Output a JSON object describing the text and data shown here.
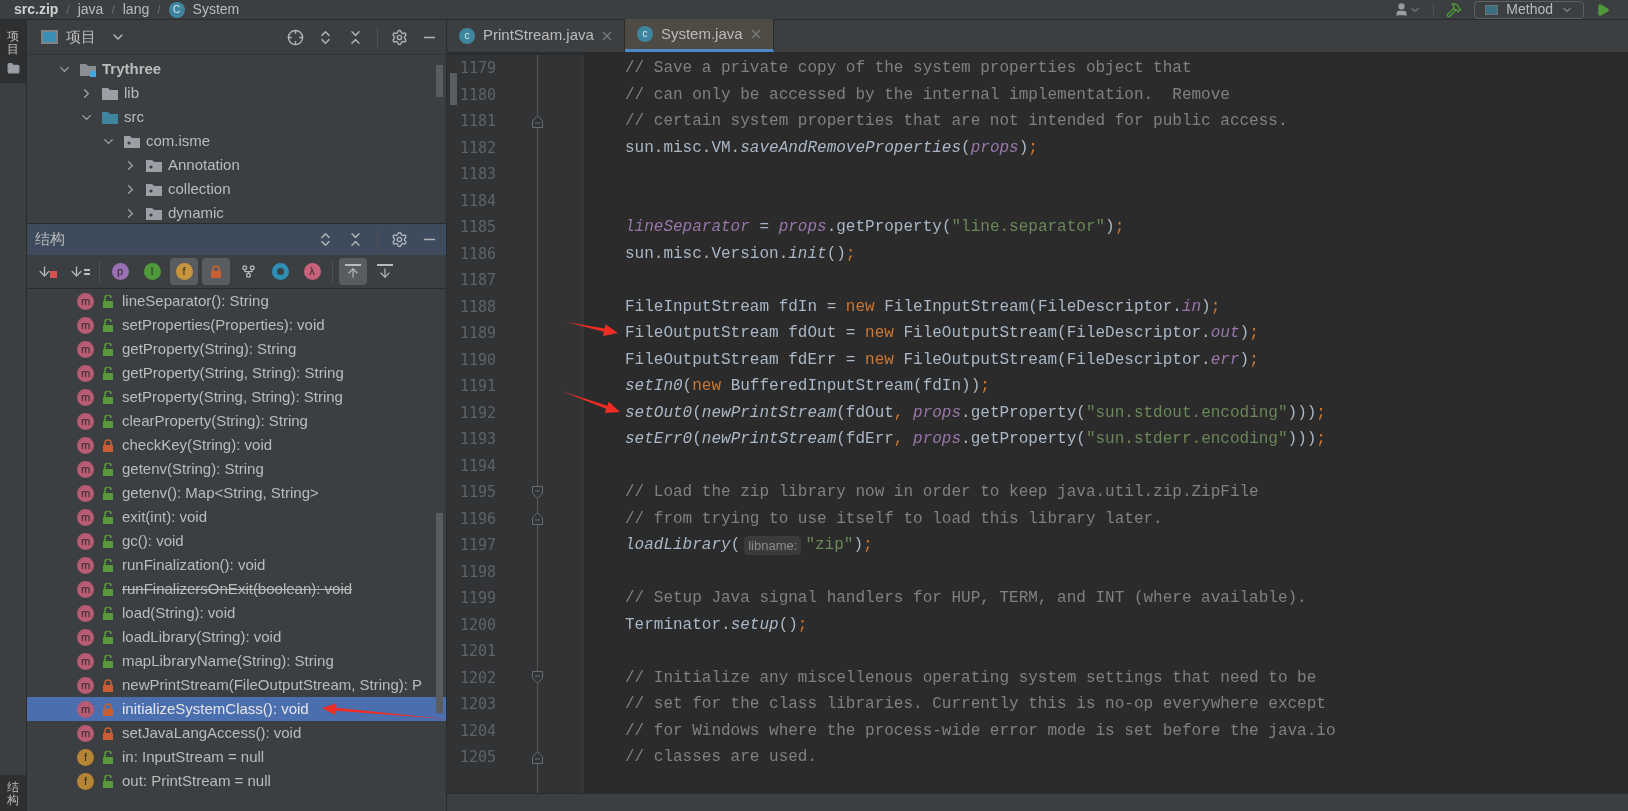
{
  "breadcrumb": [
    {
      "kind": "item",
      "label": "src.zip"
    },
    {
      "kind": "separator",
      "label": "/"
    },
    {
      "kind": "item",
      "label": "java"
    },
    {
      "kind": "separator",
      "label": "/"
    },
    {
      "kind": "item",
      "label": "lang"
    },
    {
      "kind": "separator",
      "label": "/"
    },
    {
      "kind": "item",
      "label": "System",
      "badge": "C"
    }
  ],
  "toolbar": {
    "run_config": "Method"
  },
  "side_tabs": {
    "top": {
      "label": "项目",
      "selected": true
    },
    "bottom": {
      "label": "结构",
      "selected": true
    }
  },
  "project": {
    "title": "项目",
    "tree": [
      {
        "label": "Trythree",
        "kind": "module",
        "expanded": true,
        "children": [
          {
            "label": "lib",
            "kind": "folder",
            "expanded": false
          },
          {
            "label": "src",
            "kind": "source_folder",
            "expanded": true,
            "children": [
              {
                "label": "com.isme",
                "kind": "package",
                "expanded": true,
                "children": [
                  {
                    "label": "Annotation",
                    "kind": "package",
                    "expanded": false
                  },
                  {
                    "label": "collection",
                    "kind": "package",
                    "expanded": false
                  },
                  {
                    "label": "dynamic",
                    "kind": "package",
                    "expanded": false
                  }
                ]
              }
            ]
          }
        ]
      }
    ]
  },
  "structure": {
    "title": "结构",
    "toolbar": [
      {
        "kind": "sort_visibility",
        "selected": false
      },
      {
        "kind": "sort_alpha",
        "selected": false
      },
      {
        "kind": "badge",
        "label": "p",
        "color": "#9b6fb3",
        "selected": false
      },
      {
        "kind": "badge",
        "label": "I",
        "color": "#4e9a3a",
        "selected": false
      },
      {
        "kind": "badge",
        "label": "f",
        "color": "#c7953c",
        "selected": true
      },
      {
        "kind": "lock",
        "selected": true
      },
      {
        "kind": "hierarchy",
        "selected": false
      },
      {
        "kind": "ring",
        "color": "#2e8fb5",
        "selected": false
      },
      {
        "kind": "badge",
        "label": "λ",
        "color": "#c7627a",
        "selected": false
      },
      {
        "kind": "scroll_from_source",
        "selected": true
      },
      {
        "kind": "scroll_to_source",
        "selected": false
      }
    ],
    "members": [
      {
        "kind": "method",
        "badge": "m",
        "private": false,
        "label": "lineSeparator(): String",
        "deprecated": false,
        "selected": false
      },
      {
        "kind": "method",
        "badge": "m",
        "private": false,
        "label": "setProperties(Properties): void",
        "deprecated": false,
        "selected": false
      },
      {
        "kind": "method",
        "badge": "m",
        "private": false,
        "label": "getProperty(String): String",
        "deprecated": false,
        "selected": false
      },
      {
        "kind": "method",
        "badge": "m",
        "private": false,
        "label": "getProperty(String, String): String",
        "deprecated": false,
        "selected": false
      },
      {
        "kind": "method",
        "badge": "m",
        "private": false,
        "label": "setProperty(String, String): String",
        "deprecated": false,
        "selected": false
      },
      {
        "kind": "method",
        "badge": "m",
        "private": false,
        "label": "clearProperty(String): String",
        "deprecated": false,
        "selected": false
      },
      {
        "kind": "method",
        "badge": "m",
        "private": true,
        "label": "checkKey(String): void",
        "deprecated": false,
        "selected": false
      },
      {
        "kind": "method",
        "badge": "m",
        "private": false,
        "label": "getenv(String): String",
        "deprecated": false,
        "selected": false
      },
      {
        "kind": "method",
        "badge": "m",
        "private": false,
        "label": "getenv(): Map<String, String>",
        "deprecated": false,
        "selected": false
      },
      {
        "kind": "method",
        "badge": "m",
        "private": false,
        "label": "exit(int): void",
        "deprecated": false,
        "selected": false
      },
      {
        "kind": "method",
        "badge": "m",
        "private": false,
        "label": "gc(): void",
        "deprecated": false,
        "selected": false
      },
      {
        "kind": "method",
        "badge": "m",
        "private": false,
        "label": "runFinalization(): void",
        "deprecated": false,
        "selected": false
      },
      {
        "kind": "method",
        "badge": "m",
        "private": false,
        "label": "runFinalizersOnExit(boolean): void",
        "deprecated": true,
        "selected": false
      },
      {
        "kind": "method",
        "badge": "m",
        "private": false,
        "label": "load(String): void",
        "deprecated": false,
        "selected": false
      },
      {
        "kind": "method",
        "badge": "m",
        "private": false,
        "label": "loadLibrary(String): void",
        "deprecated": false,
        "selected": false
      },
      {
        "kind": "method",
        "badge": "m",
        "private": false,
        "label": "mapLibraryName(String): String",
        "deprecated": false,
        "selected": false
      },
      {
        "kind": "method",
        "badge": "m",
        "private": true,
        "label": "newPrintStream(FileOutputStream, String): P",
        "deprecated": false,
        "selected": false
      },
      {
        "kind": "method",
        "badge": "m",
        "private": true,
        "label": "initializeSystemClass(): void",
        "deprecated": false,
        "selected": true
      },
      {
        "kind": "method",
        "badge": "m",
        "private": true,
        "label": "setJavaLangAccess(): void",
        "deprecated": false,
        "selected": false
      },
      {
        "kind": "field",
        "badge": "f",
        "private": false,
        "label": "in: InputStream = null",
        "deprecated": false,
        "selected": false
      },
      {
        "kind": "field",
        "badge": "f",
        "private": false,
        "label": "out: PrintStream = null",
        "deprecated": false,
        "selected": false
      }
    ]
  },
  "editor": {
    "tabs": [
      {
        "label": "PrintStream.java",
        "badge": "c",
        "selected": false
      },
      {
        "label": "System.java",
        "badge": "c",
        "selected": true
      }
    ],
    "lines": [
      {
        "n": "1179",
        "fold_start": false,
        "fold_end": false,
        "tokens": [
          {
            "kind": "comment",
            "text": "// Save a private copy of the system properties object that"
          }
        ]
      },
      {
        "n": "1180",
        "fold_start": false,
        "fold_end": false,
        "tokens": [
          {
            "kind": "comment",
            "text": "// can only be accessed by the internal implementation.  Remove"
          }
        ]
      },
      {
        "n": "1181",
        "fold_start": false,
        "fold_end": true,
        "tokens": [
          {
            "kind": "comment",
            "text": "// certain system properties that are not intended for public access."
          }
        ]
      },
      {
        "n": "1182",
        "fold_start": false,
        "fold_end": false,
        "tokens": [
          {
            "kind": "plain",
            "text": "sun.misc.VM."
          },
          {
            "kind": "italic",
            "text": "saveAndRemoveProperties"
          },
          {
            "kind": "plain",
            "text": "("
          },
          {
            "kind": "field",
            "text": "props"
          },
          {
            "kind": "plain",
            "text": ")"
          },
          {
            "kind": "keyword",
            "text": ";"
          }
        ]
      },
      {
        "n": "1183",
        "fold_start": false,
        "fold_end": false
      },
      {
        "n": "1184",
        "fold_start": false,
        "fold_end": false
      },
      {
        "n": "1185",
        "fold_start": false,
        "fold_end": false,
        "tokens": [
          {
            "kind": "field",
            "text": "lineSeparator"
          },
          {
            "kind": "plain",
            "text": " = "
          },
          {
            "kind": "field",
            "text": "props"
          },
          {
            "kind": "plain",
            "text": ".getProperty("
          },
          {
            "kind": "string",
            "text": "\"line.separator\""
          },
          {
            "kind": "plain",
            "text": ")"
          },
          {
            "kind": "keyword",
            "text": ";"
          }
        ]
      },
      {
        "n": "1186",
        "fold_start": false,
        "fold_end": false,
        "tokens": [
          {
            "kind": "plain",
            "text": "sun.misc.Version."
          },
          {
            "kind": "italic",
            "text": "init"
          },
          {
            "kind": "plain",
            "text": "()"
          },
          {
            "kind": "keyword",
            "text": ";"
          }
        ]
      },
      {
        "n": "1187",
        "fold_start": false,
        "fold_end": false
      },
      {
        "n": "1188",
        "fold_start": false,
        "fold_end": false,
        "tokens": [
          {
            "kind": "plain",
            "text": "FileInputStream fdIn = "
          },
          {
            "kind": "keyword",
            "text": "new"
          },
          {
            "kind": "plain",
            "text": " FileInputStream(FileDescriptor."
          },
          {
            "kind": "field",
            "text": "in"
          },
          {
            "kind": "plain",
            "text": ")"
          },
          {
            "kind": "keyword",
            "text": ";"
          }
        ]
      },
      {
        "n": "1189",
        "fold_start": false,
        "fold_end": false,
        "tokens": [
          {
            "kind": "plain",
            "text": "FileOutputStream fdOut = "
          },
          {
            "kind": "keyword",
            "text": "new"
          },
          {
            "kind": "plain",
            "text": " FileOutputStream(FileDescriptor."
          },
          {
            "kind": "field",
            "text": "out"
          },
          {
            "kind": "plain",
            "text": ")"
          },
          {
            "kind": "keyword",
            "text": ";"
          }
        ]
      },
      {
        "n": "1190",
        "fold_start": false,
        "fold_end": false,
        "tokens": [
          {
            "kind": "plain",
            "text": "FileOutputStream fdErr = "
          },
          {
            "kind": "keyword",
            "text": "new"
          },
          {
            "kind": "plain",
            "text": " FileOutputStream(FileDescriptor."
          },
          {
            "kind": "field",
            "text": "err"
          },
          {
            "kind": "plain",
            "text": ")"
          },
          {
            "kind": "keyword",
            "text": ";"
          }
        ]
      },
      {
        "n": "1191",
        "fold_start": false,
        "fold_end": false,
        "tokens": [
          {
            "kind": "italic",
            "text": "setIn0"
          },
          {
            "kind": "plain",
            "text": "("
          },
          {
            "kind": "keyword",
            "text": "new"
          },
          {
            "kind": "plain",
            "text": " BufferedInputStream(fdIn))"
          },
          {
            "kind": "keyword",
            "text": ";"
          }
        ]
      },
      {
        "n": "1192",
        "fold_start": false,
        "fold_end": false,
        "tokens": [
          {
            "kind": "italic",
            "text": "setOut0"
          },
          {
            "kind": "plain",
            "text": "("
          },
          {
            "kind": "italic",
            "text": "newPrintStream"
          },
          {
            "kind": "plain",
            "text": "(fdOut"
          },
          {
            "kind": "keyword",
            "text": ", "
          },
          {
            "kind": "field",
            "text": "props"
          },
          {
            "kind": "plain",
            "text": ".getProperty("
          },
          {
            "kind": "string",
            "text": "\"sun.stdout.encoding\""
          },
          {
            "kind": "plain",
            "text": ")))"
          },
          {
            "kind": "keyword",
            "text": ";"
          }
        ]
      },
      {
        "n": "1193",
        "fold_start": false,
        "fold_end": false,
        "tokens": [
          {
            "kind": "italic",
            "text": "setErr0"
          },
          {
            "kind": "plain",
            "text": "("
          },
          {
            "kind": "italic",
            "text": "newPrintStream"
          },
          {
            "kind": "plain",
            "text": "(fdErr"
          },
          {
            "kind": "keyword",
            "text": ", "
          },
          {
            "kind": "field",
            "text": "props"
          },
          {
            "kind": "plain",
            "text": ".getProperty("
          },
          {
            "kind": "string",
            "text": "\"sun.stderr.encoding\""
          },
          {
            "kind": "plain",
            "text": ")))"
          },
          {
            "kind": "keyword",
            "text": ";"
          }
        ]
      },
      {
        "n": "1194",
        "fold_start": false,
        "fold_end": false
      },
      {
        "n": "1195",
        "fold_start": true,
        "fold_end": false,
        "tokens": [
          {
            "kind": "comment",
            "text": "// Load the zip library now in order to keep java.util.zip.ZipFile"
          }
        ]
      },
      {
        "n": "1196",
        "fold_start": false,
        "fold_end": true,
        "tokens": [
          {
            "kind": "comment",
            "text": "// from trying to use itself to load this library later."
          }
        ]
      },
      {
        "n": "1197",
        "fold_start": false,
        "fold_end": false,
        "tokens": [
          {
            "kind": "italic",
            "text": "loadLibrary"
          },
          {
            "kind": "plain",
            "text": "("
          },
          {
            "kind": "hint",
            "text": "libname:"
          },
          {
            "kind": "string",
            "text": "\"zip\""
          },
          {
            "kind": "plain",
            "text": ")"
          },
          {
            "kind": "keyword",
            "text": ";"
          }
        ]
      },
      {
        "n": "1198",
        "fold_start": false,
        "fold_end": false
      },
      {
        "n": "1199",
        "fold_start": false,
        "fold_end": false,
        "tokens": [
          {
            "kind": "comment",
            "text": "// Setup Java signal handlers for HUP, TERM, and INT (where available)."
          }
        ]
      },
      {
        "n": "1200",
        "fold_start": false,
        "fold_end": false,
        "tokens": [
          {
            "kind": "plain",
            "text": "Terminator."
          },
          {
            "kind": "italic",
            "text": "setup"
          },
          {
            "kind": "plain",
            "text": "()"
          },
          {
            "kind": "keyword",
            "text": ";"
          }
        ]
      },
      {
        "n": "1201",
        "fold_start": false,
        "fold_end": false
      },
      {
        "n": "1202",
        "fold_start": true,
        "fold_end": false,
        "tokens": [
          {
            "kind": "comment",
            "text": "// Initialize any miscellenous operating system settings that need to be"
          }
        ]
      },
      {
        "n": "1203",
        "fold_start": false,
        "fold_end": false,
        "tokens": [
          {
            "kind": "comment",
            "text": "// set for the class libraries. Currently this is no-op everywhere except"
          }
        ]
      },
      {
        "n": "1204",
        "fold_start": false,
        "fold_end": false,
        "tokens": [
          {
            "kind": "comment",
            "text": "// for Windows where the process-wide error mode is set before the java.io"
          }
        ]
      },
      {
        "n": "1205",
        "fold_start": false,
        "fold_end": true,
        "tokens": [
          {
            "kind": "comment",
            "text": "// classes are used."
          }
        ]
      }
    ]
  }
}
